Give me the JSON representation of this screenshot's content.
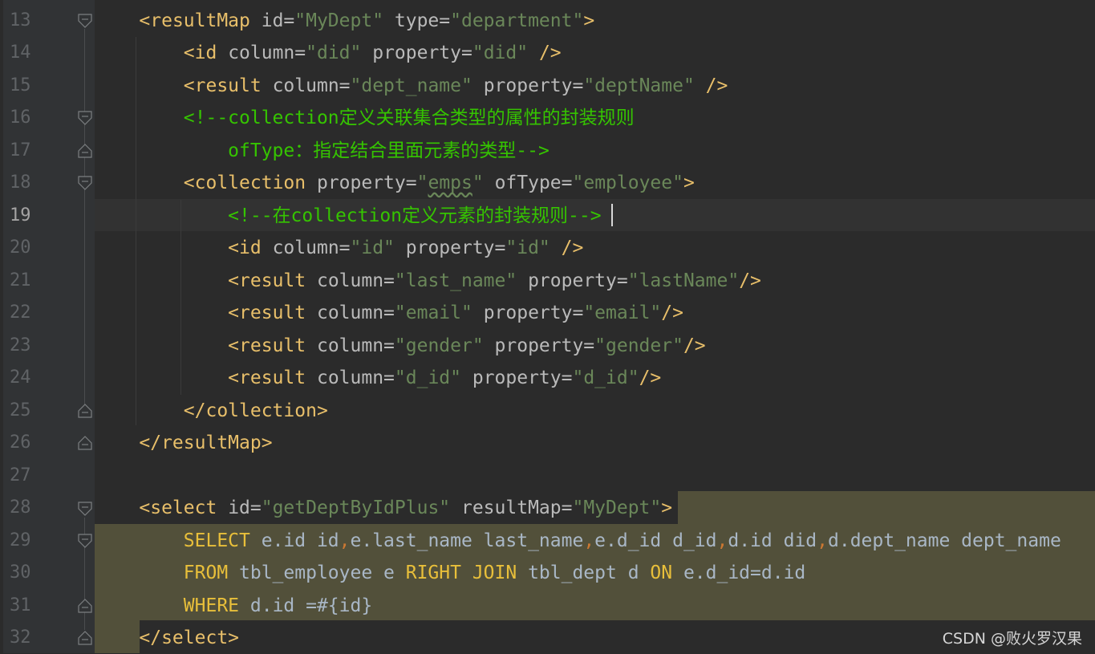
{
  "editor": {
    "line_numbers": [
      "13",
      "14",
      "15",
      "16",
      "17",
      "18",
      "19",
      "20",
      "21",
      "22",
      "23",
      "24",
      "25",
      "26",
      "27",
      "28",
      "29",
      "30",
      "31",
      "32"
    ],
    "current_line": "19"
  },
  "code": {
    "l13": {
      "open": "<",
      "tag": "resultMap",
      "a1": " id=",
      "v1": "\"MyDept\"",
      "a2": " type=",
      "v2": "\"department\"",
      "close": ">"
    },
    "l14": {
      "open": "<",
      "tag": "id",
      "a1": " column=",
      "v1": "\"did\"",
      "a2": " property=",
      "v2": "\"did\"",
      "close": " />"
    },
    "l15": {
      "open": "<",
      "tag": "result",
      "a1": " column=",
      "v1": "\"dept_name\"",
      "a2": " property=",
      "v2": "\"deptName\"",
      "close": " />"
    },
    "l16": {
      "comment": "<!--collection定义关联集合类型的属性的封装规则"
    },
    "l17": {
      "comment": "ofType：指定结合里面元素的类型-->"
    },
    "l18": {
      "open": "<",
      "tag": "collection",
      "a1": " property=",
      "v1q": "\"",
      "v1": "emps",
      "v1q2": "\"",
      "a2": " ofType=",
      "v2": "\"employee\"",
      "close": ">"
    },
    "l19": {
      "comment": "<!--在collection定义元素的封装规则-->"
    },
    "l20": {
      "open": "<",
      "tag": "id",
      "a1": " column=",
      "v1": "\"id\"",
      "a2": " property=",
      "v2": "\"id\"",
      "close": " />"
    },
    "l21": {
      "open": "<",
      "tag": "result",
      "a1": " column=",
      "v1": "\"last_name\"",
      "a2": " property=",
      "v2": "\"lastName\"",
      "close": "/>"
    },
    "l22": {
      "open": "<",
      "tag": "result",
      "a1": " column=",
      "v1": "\"email\"",
      "a2": " property=",
      "v2": "\"email\"",
      "close": "/>"
    },
    "l23": {
      "open": "<",
      "tag": "result",
      "a1": " column=",
      "v1": "\"gender\"",
      "a2": " property=",
      "v2": "\"gender\"",
      "close": "/>"
    },
    "l24": {
      "open": "<",
      "tag": "result",
      "a1": " column=",
      "v1": "\"d_id\"",
      "a2": " property=",
      "v2": "\"d_id\"",
      "close": "/>"
    },
    "l25": {
      "text": "</collection>"
    },
    "l26": {
      "text": "</resultMap>"
    },
    "l28": {
      "open": "<",
      "tag": "select",
      "a1": " id=",
      "v1": "\"getDeptByIdPlus\"",
      "a2": " resultMap=",
      "v2": "\"MyDept\"",
      "close": ">"
    },
    "l29": {
      "kw": "SELECT",
      "p1": " e.id id",
      "c1": ",",
      "p2": "e.last_name last_name",
      "c2": ",",
      "p3": "e.d_id d_id",
      "c3": ",",
      "p4": "d.id did",
      "c4": ",",
      "p5": "d.dept_name dept_name"
    },
    "l30": {
      "kw1": "FROM",
      "p1": " tbl_employee e ",
      "kw2": "RIGHT JOIN",
      "p2": " tbl_dept d ",
      "kw3": "ON",
      "p3": " e.d_id=d.id"
    },
    "l31": {
      "kw": "WHERE",
      "p1": " d.id =#{id}"
    },
    "l32": {
      "text": "</select>"
    }
  },
  "watermark": "CSDN @败火罗汉果",
  "colors": {
    "background": "#2b2b2b",
    "gutter": "#313335",
    "tag": "#e8bf6a",
    "string": "#6a8759",
    "comment": "#35c400",
    "sql_keyword": "#e8bf3a",
    "selection_highlight": "#52503a"
  }
}
